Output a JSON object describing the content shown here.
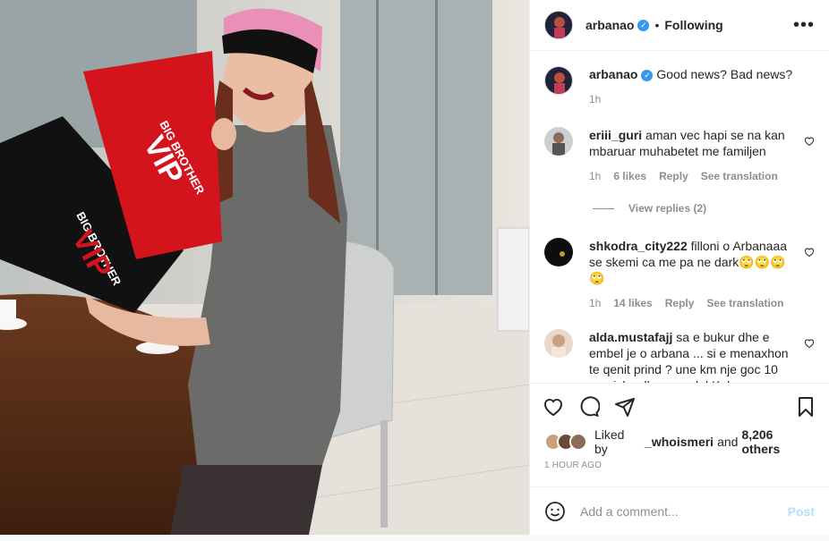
{
  "post": {
    "author": "arbanao",
    "follow_status": "Following",
    "dot": "•",
    "more": "•••",
    "caption": "Good news? Bad news?",
    "caption_time": "1h",
    "comments": [
      {
        "user": "eriii_guri",
        "text": "aman vec hapi se na kan mbaruar muhabetet me familjen",
        "time": "1h",
        "likes": "6 likes",
        "reply": "Reply",
        "translate": "See translation"
      },
      {
        "user": "shkodra_city222",
        "text": "filloni o Arbanaaa se skemi ca me pa ne dark🙄🙄🙄🙄",
        "time": "1h",
        "likes": "14 likes",
        "reply": "Reply",
        "translate": "See translation"
      },
      {
        "user": "alda.mustafajj",
        "text": "sa e bukur dhe e embel je o arbana ... si e menaxhon te qenit prind ? une km nje goc 10 muajshe dhe sme del Koha per asgje 🙄 ... si ka mundesi te shkelqesh"
      }
    ],
    "view_replies": "View replies (2)",
    "liked_by_prefix": "Liked by",
    "liked_by_user": "_whoismeri",
    "liked_by_and": "and",
    "liked_by_count": "8,206 others",
    "time_ago": "1 HOUR AGO",
    "add_comment_placeholder": "Add a comment...",
    "post_button": "Post"
  },
  "photo": {
    "bag_red_text_top": "BIG BROTHER",
    "bag_red_text_main": "VIP",
    "bag_black_text_top": "BIG BROTHER",
    "bag_black_text_main": "VIP"
  },
  "colors": {
    "verified": "#3897f0",
    "post_disabled": "#b2dffc",
    "bag_red": "#d4141c"
  }
}
